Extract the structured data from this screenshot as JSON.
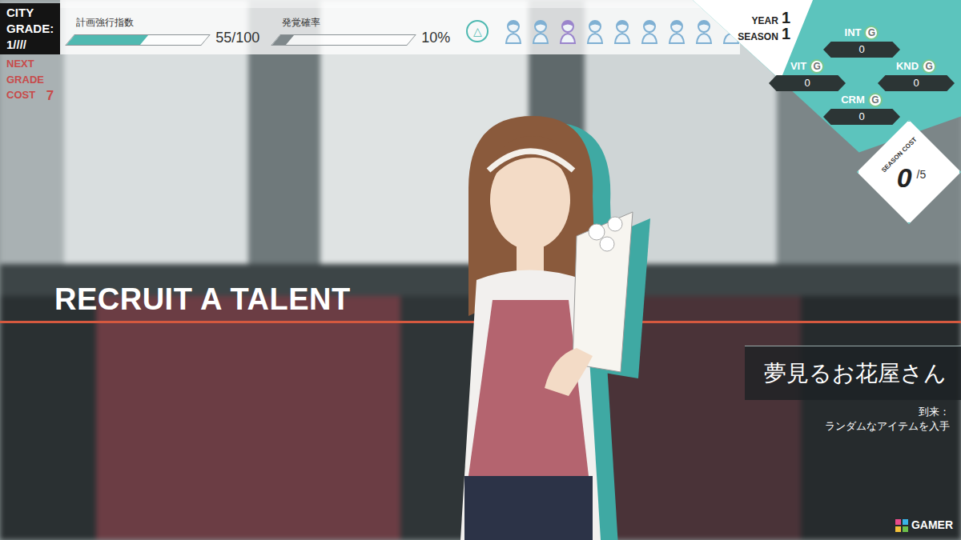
{
  "hud": {
    "city_grade": "CITY GRADE: 1////",
    "next_grade_label": "NEXT GRADE COST",
    "next_grade_cost": "7",
    "gauges": [
      {
        "label": "計画強行指数",
        "level": 0.55,
        "reading": "55/100",
        "color": "#4fb9b1"
      },
      {
        "label": "発覚確率",
        "level": 0.1,
        "reading": "10%",
        "color": "#7f888b"
      }
    ],
    "button_glyph": "△",
    "roster": [
      {
        "color": "#7fb0d3"
      },
      {
        "color": "#7fb0d3"
      },
      {
        "color": "#9a84cc"
      },
      {
        "color": "#7fb0d3"
      },
      {
        "color": "#7fb0d3"
      },
      {
        "color": "#7fb0d3"
      },
      {
        "color": "#7fb0d3"
      },
      {
        "color": "#7fb0d3"
      },
      {
        "color": "#7fb0d3"
      }
    ]
  },
  "calendar": {
    "year_label": "YEAR",
    "year": "1",
    "season_label": "SEASON",
    "season": "1"
  },
  "stats": [
    {
      "name": "INT",
      "grade": "G",
      "value": "0"
    },
    {
      "name": "VIT",
      "grade": "G",
      "value": "0"
    },
    {
      "name": "KND",
      "grade": "G",
      "value": "0"
    },
    {
      "name": "CRM",
      "grade": "G",
      "value": "0"
    }
  ],
  "season_cost": {
    "label": "SEASON COST",
    "value": "0",
    "max": "/5"
  },
  "screen_title": "RECRUIT A TALENT",
  "talent": {
    "name": "夢見るお花屋さん",
    "trigger_label": "到来：",
    "effect": "ランダムなアイテムを入手"
  },
  "watermark": "GAMER"
}
